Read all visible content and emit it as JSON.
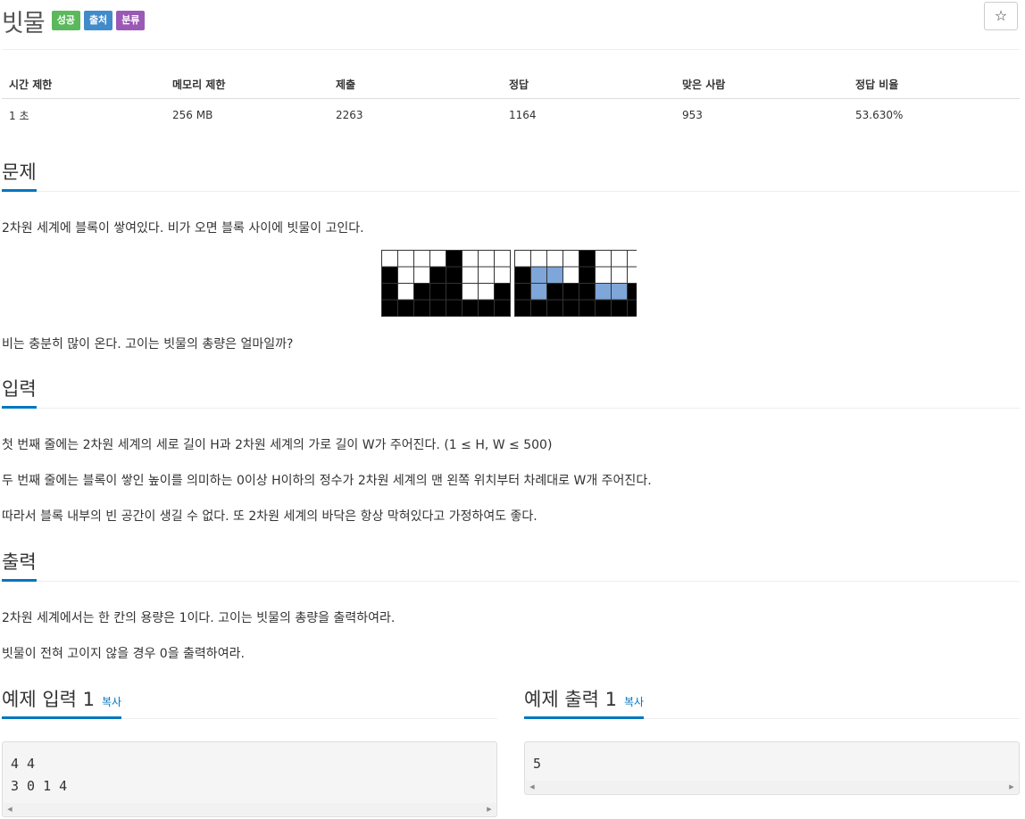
{
  "problem": {
    "title": "빗물",
    "badges": [
      "성공",
      "출처",
      "분류"
    ],
    "star": "☆"
  },
  "stats": {
    "headers": [
      "시간 제한",
      "메모리 제한",
      "제출",
      "정답",
      "맞은 사람",
      "정답 비율"
    ],
    "values": [
      "1 초",
      "256 MB",
      "2263",
      "1164",
      "953",
      "53.630%"
    ]
  },
  "description": {
    "heading": "문제",
    "p1": "2차원 세계에 블록이 쌓여있다. 비가 오면 블록 사이에 빗물이 고인다.",
    "p2": "비는 충분히 많이 온다. 고이는 빗물의 총량은 얼마일까?",
    "figure": {
      "left_grid": [
        [
          0,
          0,
          0,
          0,
          1,
          0,
          0,
          0
        ],
        [
          1,
          0,
          0,
          1,
          1,
          0,
          0,
          0
        ],
        [
          1,
          0,
          1,
          1,
          1,
          0,
          0,
          1
        ],
        [
          1,
          1,
          1,
          1,
          1,
          1,
          1,
          1
        ]
      ],
      "right_grid": [
        [
          0,
          0,
          0,
          0,
          1,
          0,
          0,
          0
        ],
        [
          1,
          2,
          2,
          0,
          1,
          0,
          0,
          0
        ],
        [
          1,
          2,
          1,
          1,
          1,
          2,
          2,
          1
        ],
        [
          1,
          1,
          1,
          1,
          1,
          1,
          1,
          1
        ]
      ],
      "colors": {
        "empty": "#ffffff",
        "block": "#000000",
        "water": "#7ea6d8"
      }
    }
  },
  "input": {
    "heading": "입력",
    "p1": "첫 번째 줄에는 2차원 세계의 세로 길이 H과 2차원 세계의 가로 길이 W가 주어진다. (1 ≤ H, W ≤ 500)",
    "p2": "두 번째 줄에는 블록이 쌓인 높이를 의미하는 0이상 H이하의 정수가 2차원 세계의 맨 왼쪽 위치부터 차례대로 W개 주어진다.",
    "p3": "따라서 블록 내부의 빈 공간이 생길 수 없다. 또 2차원 세계의 바닥은 항상 막혀있다고 가정하여도 좋다."
  },
  "output": {
    "heading": "출력",
    "p1": "2차원 세계에서는 한 칸의 용량은 1이다. 고이는 빗물의 총량을 출력하여라.",
    "p2": "빗물이 전혀 고이지 않을 경우 0을 출력하여라."
  },
  "samples": {
    "input_heading": "예제 입력 1",
    "output_heading": "예제 출력 1",
    "copy_label": "복사",
    "input_text": "4 4\n3 0 1 4",
    "output_text": "5"
  }
}
